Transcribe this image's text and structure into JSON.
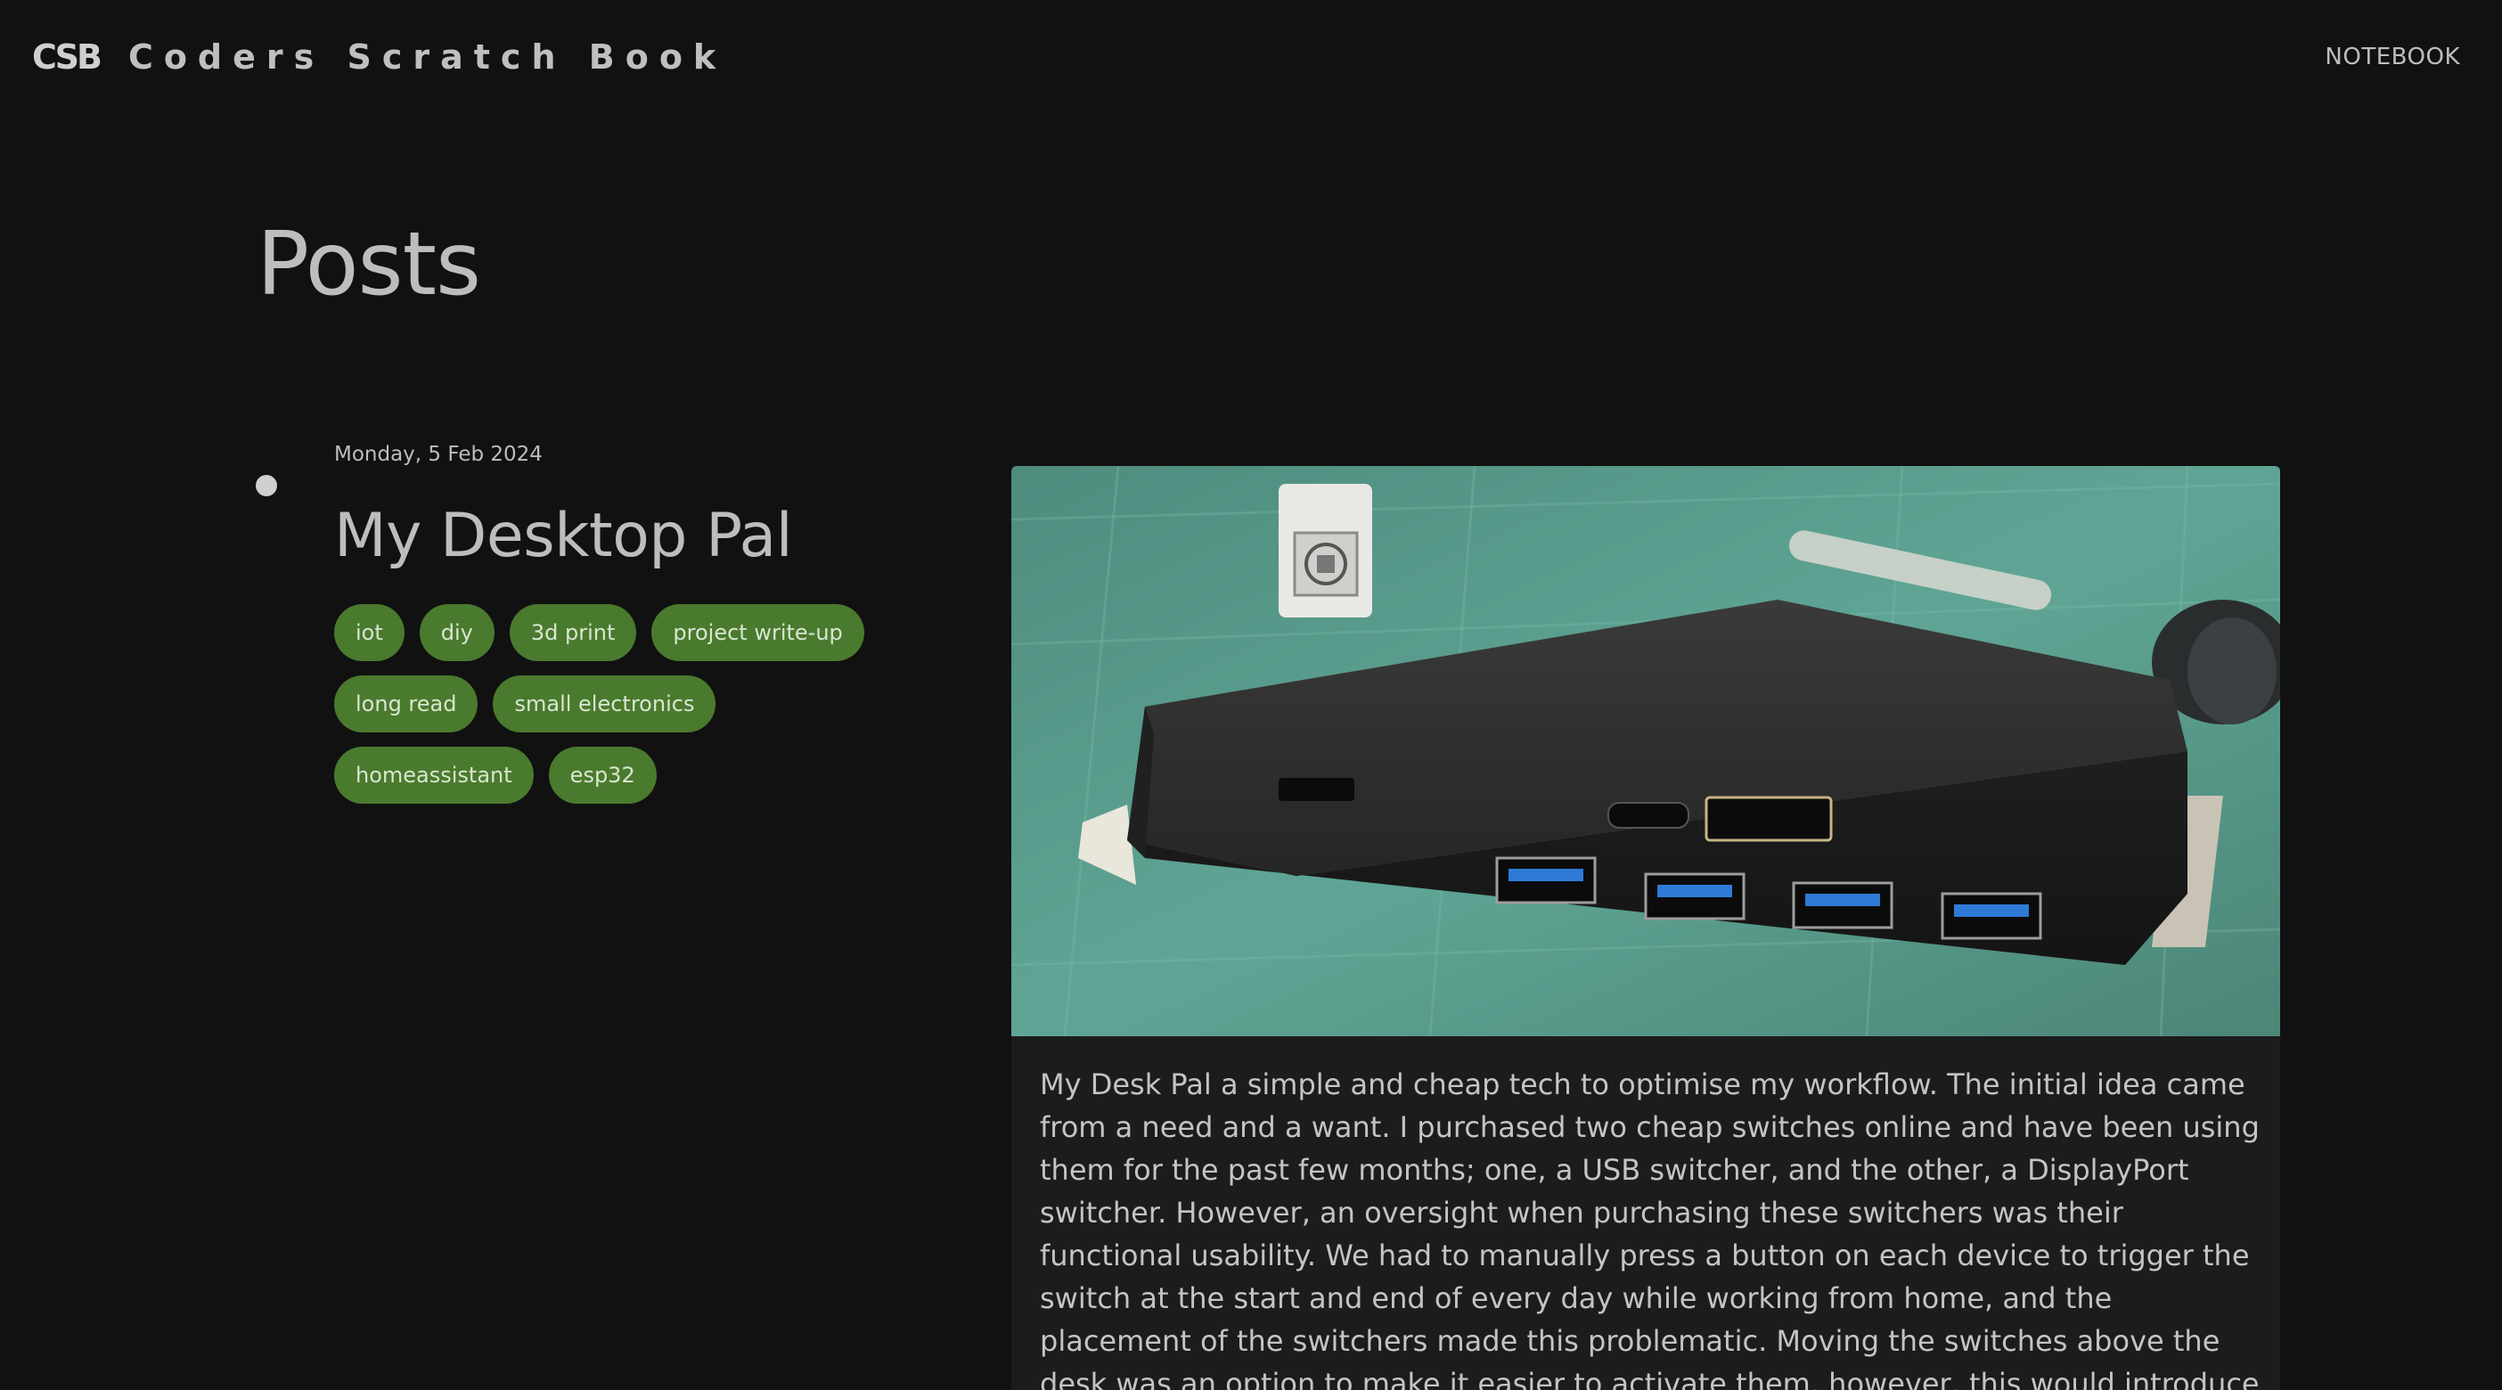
{
  "header": {
    "logo": "CSB",
    "site_name": "Coders Scratch Book",
    "nav": {
      "notebook": "NOTEBOOK"
    }
  },
  "page": {
    "title": "Posts"
  },
  "post": {
    "date": "Monday, 5 Feb 2024",
    "title": "My Desktop Pal",
    "tags": [
      "iot",
      "diy",
      "3d print",
      "project write-up",
      "long read",
      "small electronics",
      "homeassistant",
      "esp32"
    ],
    "excerpt": "My Desk Pal a simple and cheap tech to optimise my workflow. The initial idea came from a need and a want. I purchased two cheap switches online and have been using them for the past few months; one, a USB switcher, and the other, a DisplayPort switcher. However, an oversight when purchasing these switchers was their functional usability. We had to manually press a button on each device to trigger the switch at the start and end of every day while working from home, and the placement of the switchers made this problematic. Moving the switches above the desk was an option to make it easier to activate them, however, this would introduce clutter on the desk, so I wanted to avoid this option."
  },
  "colors": {
    "background": "#111111",
    "text": "#bdbdbd",
    "tag_bg": "#4a7a2e",
    "card_bg": "#1c1c1c"
  }
}
